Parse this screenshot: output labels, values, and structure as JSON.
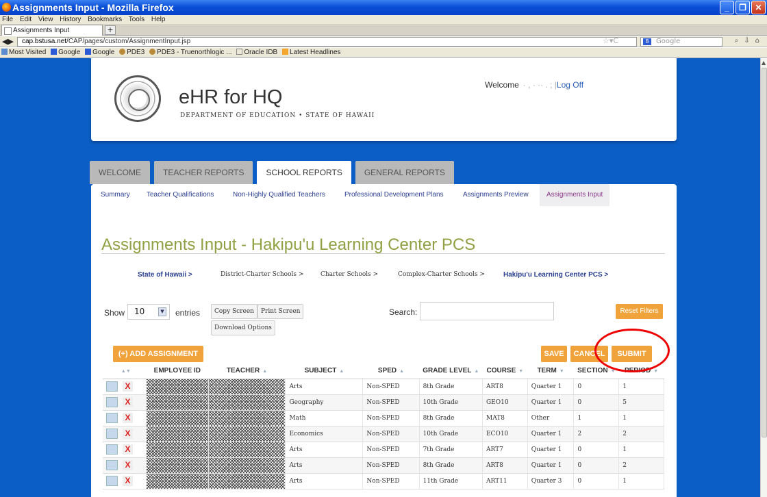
{
  "window": {
    "title": "Assignments Input - Mozilla Firefox"
  },
  "menu": [
    "File",
    "Edit",
    "View",
    "History",
    "Bookmarks",
    "Tools",
    "Help"
  ],
  "browser_tab": {
    "label": "Assignments Input",
    "new_tab": "+"
  },
  "url": {
    "domain": "cap.bstusa.net",
    "path": "/CAP/pages/custom/AssignmentInput.jsp"
  },
  "search_engine": "Google",
  "bookmarks": [
    "Most Visited",
    "Google",
    "Google",
    "PDE3",
    "PDE3 - Truenorthlogic ...",
    "Oracle IDB",
    "Latest Headlines"
  ],
  "header": {
    "brand": "eHR for HQ",
    "subtitle": "DEPARTMENT OF EDUCATION • STATE OF HAWAII",
    "welcome": "Welcome",
    "username_blurred": "· , · ··      . ; |",
    "logoff": "Log Off"
  },
  "tabs": [
    "WELCOME",
    "TEACHER REPORTS",
    "SCHOOL REPORTS",
    "GENERAL REPORTS"
  ],
  "subnav": [
    "Summary",
    "Teacher Qualifications",
    "Non-Highly Qualified Teachers",
    "Professional Development Plans",
    "Assignments Preview",
    "Assignments Input"
  ],
  "page_title": "Assignments Input - Hakipu'u Learning Center PCS",
  "breadcrumbs": [
    "State of Hawaii >",
    "District-Charter Schools >",
    "Charter Schools >",
    "Complex-Charter Schools >",
    "Hakipu'u Learning Center PCS >"
  ],
  "controls": {
    "show": "Show",
    "entries_value": "10",
    "entries": "entries",
    "copy": "Copy Screen",
    "print": "Print Screen",
    "download": "Download Options",
    "search": "Search:",
    "reset": "Reset Filters",
    "add": "(+) ADD ASSIGNMENT",
    "save": "SAVE",
    "cancel": "CANCEL",
    "submit": "SUBMIT"
  },
  "columns": [
    "EMPLOYEE ID",
    "TEACHER",
    "SUBJECT",
    "SPED",
    "GRADE LEVEL",
    "COURSE",
    "TERM",
    "SECTION",
    "PERIOD"
  ],
  "rows": [
    {
      "subject": "Arts",
      "sped": "Non-SPED",
      "grade": "8th Grade",
      "course": "ART8",
      "term": "Quarter 1",
      "section": "0",
      "period": "1"
    },
    {
      "subject": "Geography",
      "sped": "Non-SPED",
      "grade": "10th Grade",
      "course": "GEO10",
      "term": "Quarter 1",
      "section": "0",
      "period": "5"
    },
    {
      "subject": "Math",
      "sped": "Non-SPED",
      "grade": "8th Grade",
      "course": "MAT8",
      "term": "Other",
      "section": "1",
      "period": "1"
    },
    {
      "subject": "Economics",
      "sped": "Non-SPED",
      "grade": "10th Grade",
      "course": "ECO10",
      "term": "Quarter 1",
      "section": "2",
      "period": "2"
    },
    {
      "subject": "Arts",
      "sped": "Non-SPED",
      "grade": "7th Grade",
      "course": "ART7",
      "term": "Quarter 1",
      "section": "0",
      "period": "1"
    },
    {
      "subject": "Arts",
      "sped": "Non-SPED",
      "grade": "8th Grade",
      "course": "ART8",
      "term": "Quarter 1",
      "section": "0",
      "period": "2"
    },
    {
      "subject": "Arts",
      "sped": "Non-SPED",
      "grade": "11th Grade",
      "course": "ART11",
      "term": "Quarter 3",
      "section": "0",
      "period": "1"
    }
  ],
  "colors": {
    "accent": "#f0a33a",
    "title": "#8fa142",
    "nav": "#2b3f91",
    "bg": "#0b5ec6"
  }
}
